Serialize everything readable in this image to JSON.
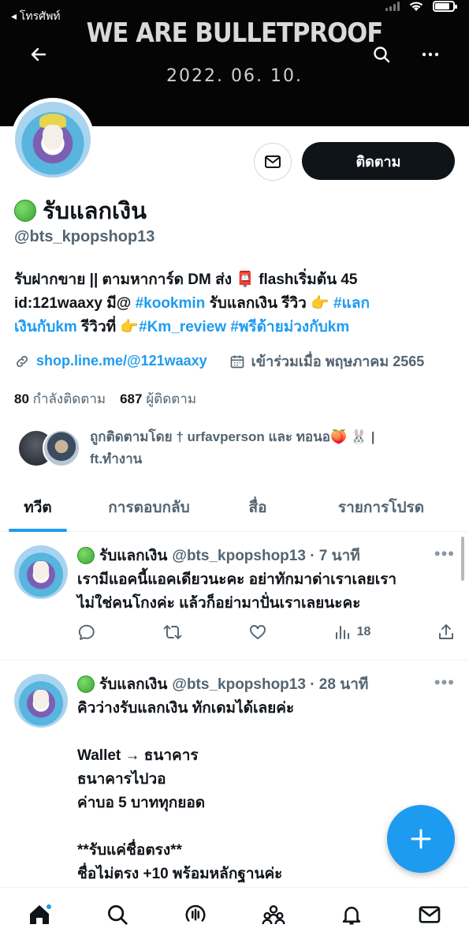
{
  "status_bar": {
    "back_label": "◂ โทรศัพท์"
  },
  "banner": {
    "title": "WE ARE BULLETPROOF",
    "date": "2022. 06. 10."
  },
  "profile": {
    "display_name": "รับแลกเงิน",
    "handle": "@bts_kpopshop13",
    "follow_label": "ติดตาม",
    "bio": {
      "line1": "รับฝากขาย || ตามหาการ์ด DM ส่ง 📮 flashเริ่มต้น 45",
      "line2a": "id:121waaxy มี@ ",
      "tag1": "#kookmin",
      "line2b": " รับแลกเงิน รีวิว 👉 ",
      "tag2a": "#แลก",
      "tag2b": "เงินกับkm",
      "line3a": " รีวิวที่ 👉",
      "tag3": "#Km_review",
      "tag4": "#พรีด้ายม่วงกับkm"
    },
    "link": "shop.line.me/@121waaxy",
    "joined": "เข้าร่วมเมื่อ พฤษภาคม 2565",
    "following_count": "80",
    "following_label": "กำลังติดตาม",
    "followers_count": "687",
    "followers_label": "ผู้ติดตาม",
    "followed_by": {
      "prefix": "ถูกติดตามโดย ",
      "user1": "† urfavperson",
      "mid": " และ ",
      "user2": "ทอนอ",
      "suffix": "🍑 🐰 |",
      "line2": "ft.ทำงาน"
    }
  },
  "tabs": [
    "ทวีต",
    "การตอบกลับ",
    "สื่อ",
    "รายการโปรด"
  ],
  "tweets": [
    {
      "name": "รับแลกเงิน",
      "handle_time": "@bts_kpopshop13 · 7 นาที",
      "text": "เรามีแอคนี้แอคเดียวนะคะ อย่าทักมาด่าเราเลยเรา\nไม่ใช่คนโกงค่ะ แล้วก็อย่ามาปั่นเราเลยนะคะ",
      "views": "18"
    },
    {
      "name": "รับแลกเงิน",
      "handle_time": "@bts_kpopshop13 · 28 นาที",
      "text": "คิวว่างรับแลกเงิน ทักเดมได้เลยค่ะ\n\nWallet → ธนาคาร\nธนาคารไปวอ\nค่าบอ 5 บาททุกยอด\n\n**รับแค่ชื่อตรง**\nชื่อไม่ตรง +10 พร้อมหลักฐานค่ะ"
    }
  ],
  "icons": {
    "back": "arrow-left-icon",
    "search": "search-icon",
    "more": "more-icon",
    "mail": "mail-icon",
    "link": "link-icon",
    "calendar": "calendar-icon",
    "reply": "reply-icon",
    "retweet": "retweet-icon",
    "like": "heart-icon",
    "views": "views-icon",
    "share": "share-icon",
    "compose": "plus-icon",
    "home": "home-icon",
    "explore": "search-icon",
    "spaces": "spaces-icon",
    "communities": "communities-icon",
    "notifications": "bell-icon",
    "messages": "mail-icon"
  },
  "colors": {
    "accent": "#1d9bf0",
    "text": "#0f1419",
    "muted": "#536471",
    "banner_bg": "#050505"
  }
}
